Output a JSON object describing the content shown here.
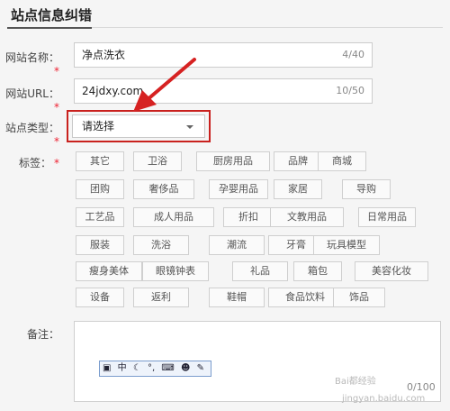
{
  "page": {
    "title": "站点信息纠错"
  },
  "form": {
    "site_name": {
      "label": "网站名称：",
      "value": "净点洗衣",
      "counter": "4/40"
    },
    "site_url": {
      "label": "网站URL：",
      "value": "24jdxy.com",
      "counter": "10/50"
    },
    "site_type": {
      "label": "站点类型：",
      "selected": "请选择"
    },
    "tags_label": "标签：",
    "note_label": "备注：",
    "note_counter": "0/100",
    "required_mark": "*"
  },
  "tags": [
    "其它",
    "卫浴",
    "厨房用品",
    "品牌",
    "商城",
    "团购",
    "奢侈品",
    "孕婴用品",
    "家居",
    "导购",
    "工艺品",
    "成人用品",
    "折扣",
    "文教用品",
    "日常用品",
    "服装",
    "洗浴",
    "潮流",
    "牙膏",
    "玩具模型",
    "瘦身美体",
    "眼镜钟表",
    "礼品",
    "箱包",
    "美容化妆",
    "设备",
    "返利",
    "鞋帽",
    "食品饮料",
    "饰品"
  ],
  "ime_toolbar": {
    "mode": "中",
    "icons": [
      "ime-logo-icon",
      "moon-icon",
      "punctuation-icon",
      "keyboard-icon",
      "user-icon",
      "wrench-icon"
    ]
  },
  "watermark": {
    "line1": "Bai都经验",
    "line2": "jingyan.baidu.com"
  },
  "colors": {
    "required": "#e22233",
    "highlight": "#c9211e",
    "arrow": "#d62222"
  }
}
